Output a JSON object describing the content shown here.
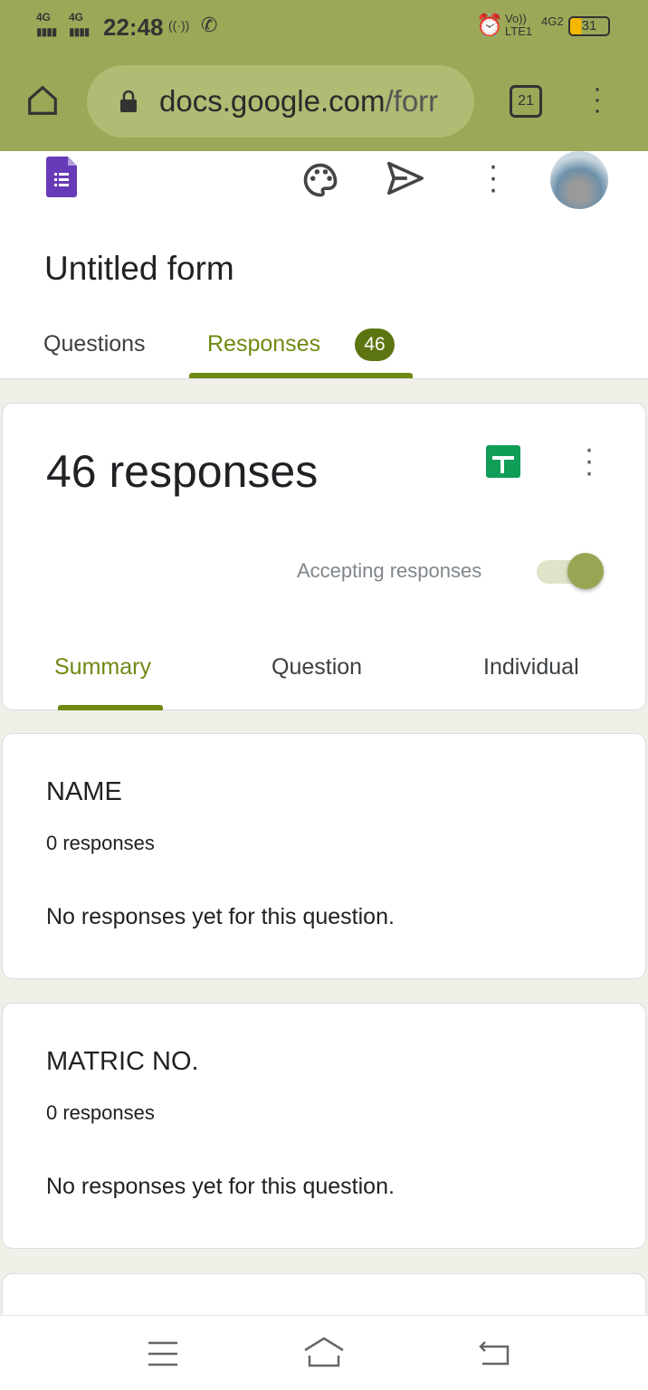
{
  "status_bar": {
    "signal1": "4G",
    "signal2": "4G",
    "time": "22:48",
    "volte": "Vo)) LTE1",
    "network": "4G2",
    "battery": "31"
  },
  "browser": {
    "url_main": "docs.google.com",
    "url_rest": "/forr",
    "tab_count": "21"
  },
  "form": {
    "title": "Untitled form",
    "tabs": [
      {
        "label": "Questions"
      },
      {
        "label": "Responses",
        "badge": "46"
      }
    ]
  },
  "summary_card": {
    "heading": "46 responses",
    "accepting_label": "Accepting responses",
    "accepting": true,
    "subtabs": [
      "Summary",
      "Question",
      "Individual"
    ]
  },
  "questions": [
    {
      "title": "NAME",
      "count": "0 responses",
      "empty": "No responses yet for this question."
    },
    {
      "title": "MATRIC NO.",
      "count": "0 responses",
      "empty": "No responses yet for this question."
    }
  ],
  "colors": {
    "toolbar": "#9ca857",
    "accent": "#6f8a12",
    "badge": "#5d7510",
    "sheets": "#0f9d58",
    "forms": "#673ab7"
  }
}
